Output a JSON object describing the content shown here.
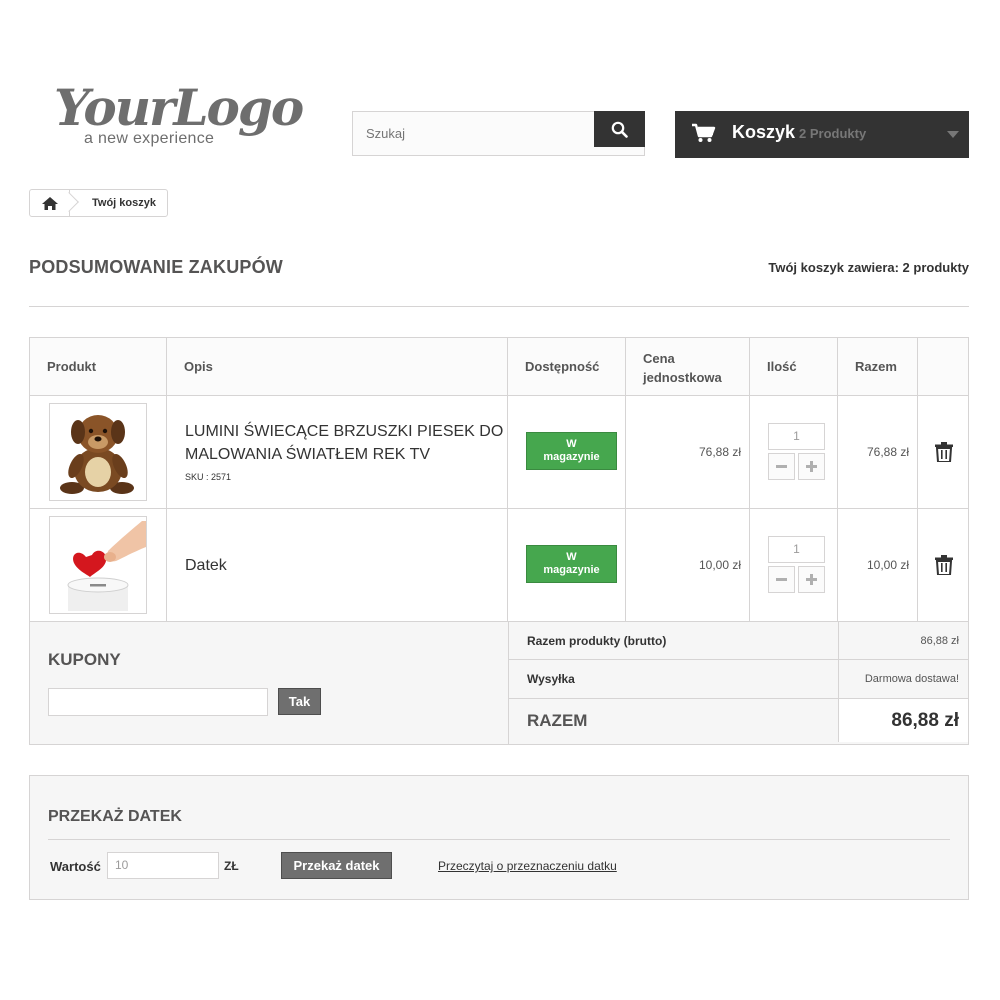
{
  "header": {
    "logo_text": "YourLogo",
    "logo_tagline": "a new experience",
    "search_placeholder": "Szukaj",
    "cart_title": "Koszyk",
    "cart_count": "2 Produkty"
  },
  "breadcrumb": {
    "current": "Twój koszyk"
  },
  "page": {
    "title": "PODSUMOWANIE ZAKUPÓW",
    "summary": "Twój koszyk zawiera: 2 produkty"
  },
  "table": {
    "headers": {
      "product": "Produkt",
      "description": "Opis",
      "availability": "Dostępność",
      "unit_price_line1": "Cena",
      "unit_price_line2": "jednostkowa",
      "quantity": "Ilość",
      "total": "Razem"
    },
    "items": [
      {
        "name_line1": "LUMINI ŚWIECĄCE BRZUSZKI PIESEK DO",
        "name_line2": "MALOWANIA ŚWIATŁEM REK TV",
        "sku": "SKU : 2571",
        "availability_line1": "W",
        "availability_line2": "magazynie",
        "unit_price": "76,88 zł",
        "quantity": "1",
        "total": "76,88 zł"
      },
      {
        "name": "Datek",
        "availability_line1": "W",
        "availability_line2": "magazynie",
        "unit_price": "10,00 zł",
        "quantity": "1",
        "total": "10,00 zł"
      }
    ]
  },
  "coupons": {
    "title": "KUPONY",
    "button": "Tak"
  },
  "totals": {
    "products_label": "Razem produkty (brutto)",
    "products_value": "86,88 zł",
    "shipping_label": "Wysyłka",
    "shipping_value": "Darmowa dostawa!",
    "total_label": "RAZEM",
    "total_value": "86,88 zł"
  },
  "donation": {
    "title": "PRZEKAŻ DATEK",
    "value_label": "Wartość",
    "value": "10",
    "unit": "ZŁ",
    "button": "Przekaż datek",
    "link": "Przeczytaj o przeznaczeniu datku"
  },
  "colors": {
    "dark": "#333333",
    "in_stock_green": "#46a74e",
    "button_gray": "#6f6f6f",
    "border": "#d6d4d4"
  }
}
